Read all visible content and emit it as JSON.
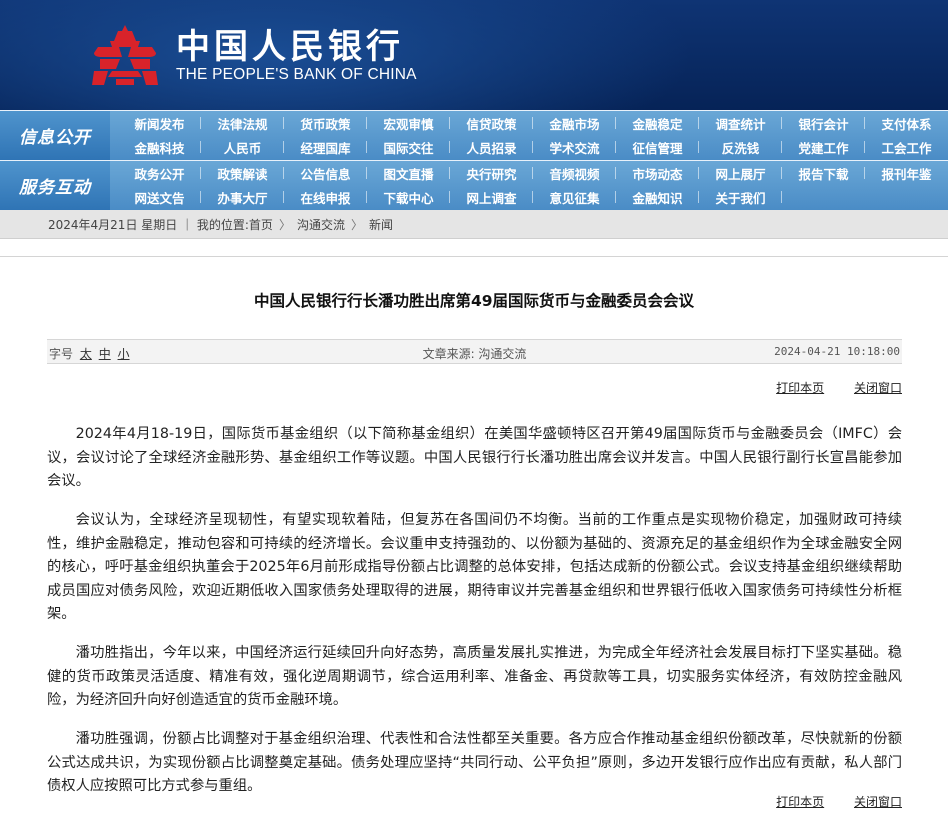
{
  "header": {
    "brand_cn": "中国人民银行",
    "brand_en": "THE PEOPLE'S BANK OF CHINA",
    "colors": {
      "header_bg": "#0a2a63",
      "emblem": "#d8232a",
      "nav_bg": "#5a9bd0"
    }
  },
  "nav": {
    "info": {
      "label": "信息公开",
      "items": [
        "新闻发布",
        "法律法规",
        "货币政策",
        "宏观审慎",
        "信贷政策",
        "金融市场",
        "金融稳定",
        "调查统计",
        "银行会计",
        "支付体系",
        "金融科技",
        "人民币",
        "经理国库",
        "国际交往",
        "人员招录",
        "学术交流",
        "征信管理",
        "反洗钱",
        "党建工作",
        "工会工作"
      ]
    },
    "service": {
      "label": "服务互动",
      "items": [
        "政务公开",
        "政策解读",
        "公告信息",
        "图文直播",
        "央行研究",
        "音频视频",
        "市场动态",
        "网上展厅",
        "报告下载",
        "报刊年鉴",
        "网送文告",
        "办事大厅",
        "在线申报",
        "下载中心",
        "网上调查",
        "意见征集",
        "金融知识",
        "关于我们"
      ]
    }
  },
  "breadcrumb": {
    "text": "2024年4月21日 星期日 ｜ 我的位置:首页",
    "sep": "〉",
    "items": [
      "沟通交流",
      "新闻"
    ]
  },
  "article": {
    "title": "中国人民银行行长潘功胜出席第49届国际货币与金融委员会会议",
    "font_size_label": "字号",
    "font_sizes": [
      "太",
      "中",
      "小"
    ],
    "source": "文章来源: 沟通交流",
    "date": "2024-04-21 10:18:00",
    "print_label": "打印本页",
    "close_label": "关闭窗口",
    "paragraphs": [
      "2024年4月18-19日，国际货币基金组织（以下简称基金组织）在美国华盛顿特区召开第49届国际货币与金融委员会（IMFC）会议，会议讨论了全球经济金融形势、基金组织工作等议题。中国人民银行行长潘功胜出席会议并发言。中国人民银行副行长宣昌能参加会议。",
      "会议认为，全球经济呈现韧性，有望实现软着陆，但复苏在各国间仍不均衡。当前的工作重点是实现物价稳定，加强财政可持续性，维护金融稳定，推动包容和可持续的经济增长。会议重申支持强劲的、以份额为基础的、资源充足的基金组织作为全球金融安全网的核心，呼吁基金组织执董会于2025年6月前形成指导份额占比调整的总体安排，包括达成新的份额公式。会议支持基金组织继续帮助成员国应对债务风险，欢迎近期低收入国家债务处理取得的进展，期待审议并完善基金组织和世界银行低收入国家债务可持续性分析框架。",
      "潘功胜指出，今年以来，中国经济运行延续回升向好态势，高质量发展扎实推进，为完成全年经济社会发展目标打下坚实基础。稳健的货币政策灵活适度、精准有效，强化逆周期调节，综合运用利率、准备金、再贷款等工具，切实服务实体经济，有效防控金融风险，为经济回升向好创造适宜的货币金融环境。",
      "潘功胜强调，份额占比调整对于基金组织治理、代表性和合法性都至关重要。各方应合作推动基金组织份额改革，尽快就新的份额公式达成共识，为实现份额占比调整奠定基础。债务处理应坚持“共同行动、公平负担”原则，多边开发银行应作出应有贡献，私人部门债权人应按照可比方式参与重组。"
    ]
  }
}
